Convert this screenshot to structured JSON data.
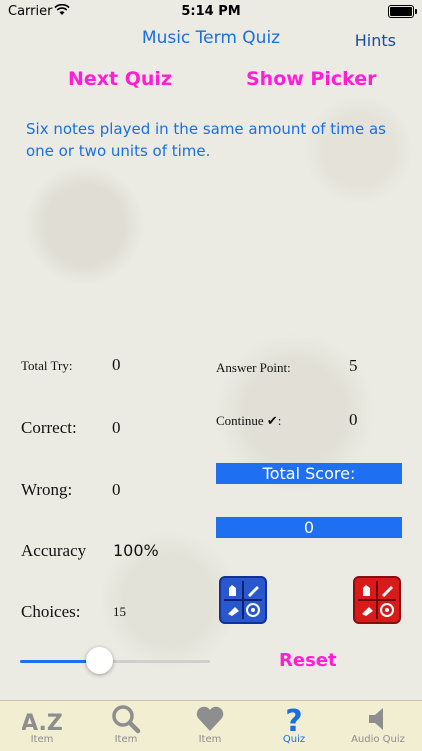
{
  "status": {
    "carrier": "Carrier",
    "time": "5:14 PM"
  },
  "header": {
    "title": "Music Term Quiz",
    "hints": "Hints"
  },
  "actions": {
    "next_quiz": "Next Quiz",
    "show_picker": "Show Picker",
    "reset": "Reset"
  },
  "question": "Six notes played in the same amount of time as one or two units of time.",
  "stats": {
    "total_try_label": "Total Try:",
    "total_try": "0",
    "correct_label": "Correct:",
    "correct": "0",
    "wrong_label": "Wrong:",
    "wrong": "0",
    "accuracy_label": "Accuracy",
    "accuracy": "100%",
    "choices_label": "Choices:",
    "choices": "15",
    "answer_point_label": "Answer Point:",
    "answer_point": "5",
    "continue_label": "Continue ✔:",
    "continue": "0",
    "total_score_label": "Total Score:",
    "total_score": "0"
  },
  "slider": {
    "value": 0.42
  },
  "tabs": [
    {
      "label": "Item",
      "icon": "az-icon"
    },
    {
      "label": "Item",
      "icon": "search-icon"
    },
    {
      "label": "Item",
      "icon": "heart-icon"
    },
    {
      "label": "Quiz",
      "icon": "question-icon",
      "active": true
    },
    {
      "label": "Audio Quiz",
      "icon": "speaker-icon"
    }
  ],
  "colors": {
    "accent": "#1f6ff2",
    "magenta": "#ff1ed6",
    "tab_active": "#1a6fe0",
    "blue_button": "#2957cc",
    "red_button": "#d91a1a"
  }
}
